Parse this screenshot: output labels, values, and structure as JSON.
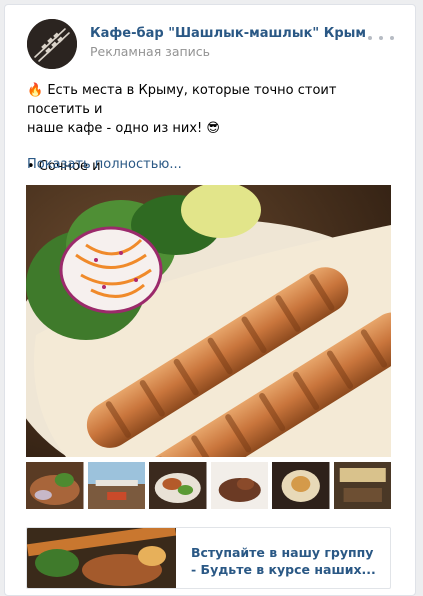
{
  "post": {
    "group_name": "Кафе-бар \"Шашлык-машлык\" Крым",
    "ad_label": "Рекламная запись",
    "more_icon": "more-dots-icon",
    "text_line1": "🔥 Есть места в Крыму, которые точно стоит посетить и",
    "text_line2": "наше кафе - одно из них! 😎",
    "text_line3": "• Сочное и",
    "show_more": "Показать полностью..."
  },
  "link_card": {
    "title": "Вступайте в нашу группу - Будьте в курсе наших..."
  },
  "colors": {
    "link": "#2a5885",
    "secondary_text": "#939393",
    "page_bg": "#edeef0"
  }
}
